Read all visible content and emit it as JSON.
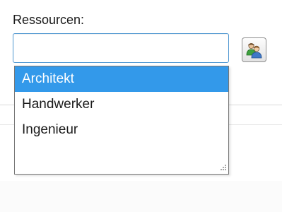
{
  "form": {
    "label": "Ressourcen:",
    "input_value": "",
    "picker_icon": "users-icon"
  },
  "dropdown": {
    "options": [
      {
        "label": "Architekt",
        "selected": true
      },
      {
        "label": "Handwerker",
        "selected": false
      },
      {
        "label": "Ingenieur",
        "selected": false
      }
    ],
    "resize_icon": "resize-grip-icon"
  },
  "colors": {
    "selection": "#3399ea",
    "input_border": "#4f97d1",
    "icon_green": "#3ea13e",
    "icon_blue": "#3f78c6"
  }
}
